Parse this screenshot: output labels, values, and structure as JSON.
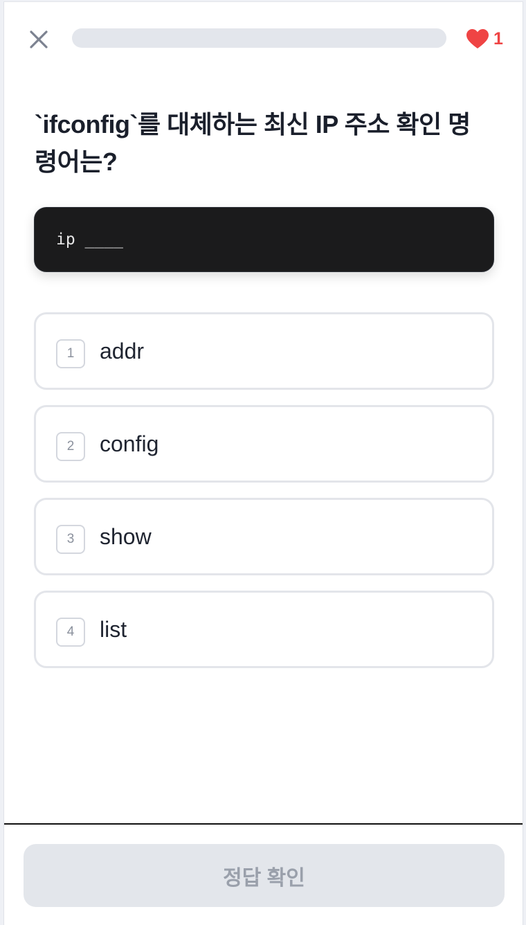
{
  "header": {
    "close_icon": "close-icon",
    "progress": 0,
    "lives_icon": "heart-icon",
    "lives_count": "1",
    "colors": {
      "heart": "#ef4444",
      "progress_track": "#e3e6ec"
    }
  },
  "question": {
    "text": "`ifconfig`를 대체하는 최신 IP 주소 확인 명령어는?"
  },
  "code": {
    "text": "ip ____"
  },
  "options": [
    {
      "number": "1",
      "label": "addr"
    },
    {
      "number": "2",
      "label": "config"
    },
    {
      "number": "3",
      "label": "show"
    },
    {
      "number": "4",
      "label": "list"
    }
  ],
  "footer": {
    "check_label": "정답 확인",
    "check_disabled": true
  }
}
